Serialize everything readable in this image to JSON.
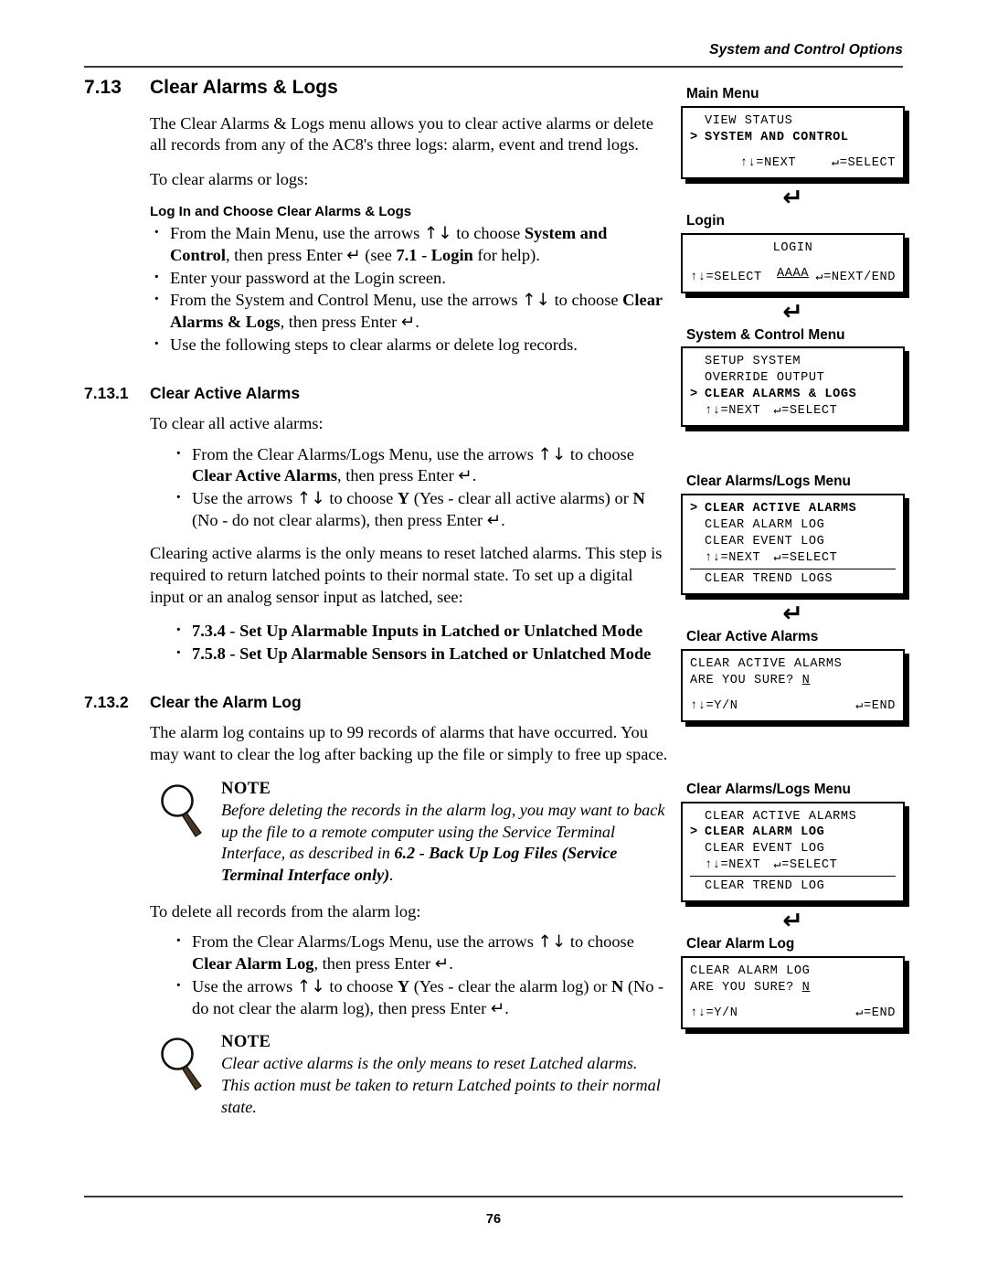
{
  "header": {
    "running_head": "System and Control Options"
  },
  "footer": {
    "page_number": "76"
  },
  "sections": {
    "s713": {
      "number": "7.13",
      "title": "Clear Alarms & Logs",
      "intro": "The Clear Alarms & Logs menu allows you to clear active alarms or delete all records from any of the AC8's three logs: alarm, event and trend logs.",
      "lead": "To clear alarms or logs:",
      "subhead": "Log In and Choose Clear Alarms & Logs",
      "bullets": [
        "From the Main Menu, use the arrows ↑↓ to choose System and Control, then press Enter ↵ (see 7.1 - Login for help).",
        "Enter your password at the Login screen.",
        "From the System and Control Menu, use the arrows ↑↓ to choose Clear Alarms & Logs, then press Enter ↵.",
        "Use the following steps to clear alarms or delete log records."
      ]
    },
    "s7131": {
      "number": "7.13.1",
      "title": "Clear Active Alarms",
      "lead": "To clear all active alarms:",
      "bullets": [
        "From the Clear Alarms/Logs Menu, use the arrows ↑↓ to choose Clear Active Alarms, then press Enter ↵.",
        "Use the arrows ↑↓ to choose Y (Yes - clear all active alarms) or N (No - do not clear alarms), then press Enter ↵."
      ],
      "para": "Clearing active alarms is the only means to reset latched alarms. This step is required to return latched points to their normal state. To set up a digital input or an analog sensor input as latched, see:",
      "refs": [
        "7.3.4 - Set Up Alarmable Inputs in Latched or Unlatched Mode",
        "7.5.8 - Set Up Alarmable Sensors in Latched or Unlatched Mode"
      ]
    },
    "s7132": {
      "number": "7.13.2",
      "title": "Clear the Alarm Log",
      "para": "The alarm log contains up to 99 records of alarms that have occurred. You may want to clear the log after backing up the file or simply to free up space.",
      "note1": {
        "title": "NOTE",
        "text": "Before deleting the records in the alarm log, you may want to back up the file to a remote computer using the Service Terminal Interface, as described in 6.2 - Back Up Log Files (Service Terminal Interface only)."
      },
      "lead": "To delete all records from the alarm log:",
      "bullets": [
        "From the Clear Alarms/Logs Menu, use the arrows ↑↓ to choose Clear Alarm Log, then press Enter ↵.",
        "Use the arrows ↑↓ to choose Y (Yes - clear the alarm log) or N (No - do not clear the alarm log), then press Enter ↵."
      ],
      "note2": {
        "title": "NOTE",
        "text": "Clear active alarms is the only means to reset Latched alarms. This action must be taken to return Latched points to their normal state."
      }
    }
  },
  "panels": [
    {
      "label": "Main Menu",
      "lines": [
        {
          "marker": "",
          "text": "VIEW STATUS",
          "bold": false
        },
        {
          "marker": ">",
          "text": "SYSTEM AND CONTROL",
          "bold": true
        },
        {
          "blank": true
        },
        {
          "left": "↑↓=NEXT",
          "right": "↵=SELECT",
          "bold": false
        }
      ]
    },
    {
      "label": "Login",
      "lines": [
        {
          "center": "LOGIN"
        },
        {
          "blank": true
        },
        {
          "center_underline": "AAAA"
        },
        {
          "left": "↑↓=SELECT",
          "right": "↵=NEXT/END",
          "bold": false
        }
      ]
    },
    {
      "label": "System & Control Menu",
      "lines": [
        {
          "marker": "",
          "text": "SETUP SYSTEM",
          "bold": false
        },
        {
          "marker": "",
          "text": "OVERRIDE OUTPUT",
          "bold": false
        },
        {
          "marker": ">",
          "text": "CLEAR ALARMS & LOGS",
          "bold": true
        },
        {
          "left": "↑↓=NEXT",
          "right": "↵=SELECT",
          "indent": true
        }
      ]
    },
    {
      "label": "Clear Alarms/Logs Menu",
      "lines": [
        {
          "marker": ">",
          "text": "CLEAR ACTIVE ALARMS",
          "bold": true
        },
        {
          "marker": "",
          "text": "CLEAR ALARM LOG",
          "bold": false
        },
        {
          "marker": "",
          "text": "CLEAR EVENT LOG",
          "bold": false
        },
        {
          "left": "↑↓=NEXT",
          "right": "↵=SELECT",
          "indent": true
        },
        {
          "divider": true
        },
        {
          "marker": "",
          "text": "CLEAR TREND LOGS",
          "bold": false
        }
      ]
    },
    {
      "label": "Clear Active Alarms",
      "lines": [
        {
          "marker": "",
          "text": "CLEAR ACTIVE ALARMS",
          "bold": false,
          "flush": true
        },
        {
          "marker": "",
          "text": "ARE YOU SURE? N",
          "bold": false,
          "flush": true,
          "underline_last": true
        },
        {
          "blank": true
        },
        {
          "left": "↑↓=Y/N",
          "right": "↵=END",
          "flush": true
        }
      ]
    },
    {
      "label": "Clear Alarms/Logs Menu",
      "lines": [
        {
          "marker": "",
          "text": "CLEAR ACTIVE ALARMS",
          "bold": false
        },
        {
          "marker": ">",
          "text": "CLEAR ALARM LOG",
          "bold": true
        },
        {
          "marker": "",
          "text": "CLEAR EVENT LOG",
          "bold": false
        },
        {
          "left": "↑↓=NEXT",
          "right": "↵=SELECT",
          "indent": true
        },
        {
          "divider": true
        },
        {
          "marker": "",
          "text": "CLEAR TREND LOG",
          "bold": false
        }
      ]
    },
    {
      "label": "Clear Alarm Log",
      "lines": [
        {
          "marker": "",
          "text": "CLEAR ALARM LOG",
          "bold": false,
          "flush": true
        },
        {
          "marker": "",
          "text": "ARE YOU SURE? N",
          "bold": false,
          "flush": true,
          "underline_last": true
        },
        {
          "blank": true
        },
        {
          "left": "↑↓=Y/N",
          "right": "↵=END",
          "flush": true
        }
      ]
    }
  ],
  "icons": {
    "enter_arrow": "↵",
    "magnifier": "magnifier-icon"
  }
}
